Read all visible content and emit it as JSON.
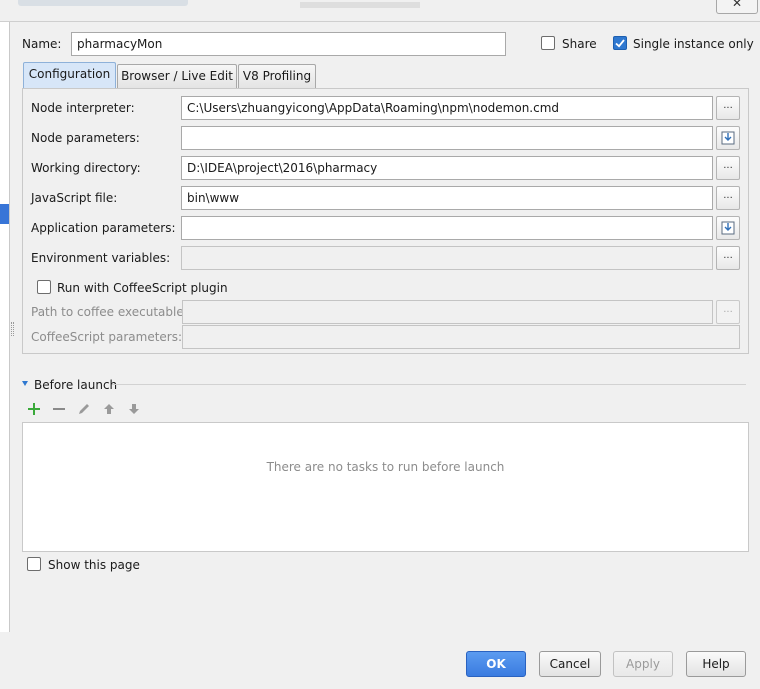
{
  "window": {
    "close_label": "✕"
  },
  "header": {
    "name_label": "Name:",
    "name_value": "pharmacyMon",
    "share_label": "Share",
    "share_checked": false,
    "single_instance_label": "Single instance only",
    "single_instance_checked": true
  },
  "tabs": [
    {
      "label": "Configuration",
      "active": true
    },
    {
      "label": "Browser / Live Edit",
      "active": false
    },
    {
      "label": "V8 Profiling",
      "active": false
    }
  ],
  "config": {
    "node_interpreter": {
      "label": "Node interpreter:",
      "value": "C:\\Users\\zhuangyicong\\AppData\\Roaming\\npm\\nodemon.cmd",
      "button": "..."
    },
    "node_parameters": {
      "label": "Node parameters:",
      "value": ""
    },
    "working_directory": {
      "label": "Working directory:",
      "value": "D:\\IDEA\\project\\2016\\pharmacy",
      "button": "..."
    },
    "javascript_file": {
      "label": "JavaScript file:",
      "value": "bin\\www",
      "button": "..."
    },
    "application_parameters": {
      "label": "Application parameters:",
      "value": ""
    },
    "environment_variables": {
      "label": "Environment variables:",
      "value": "",
      "button": "..."
    },
    "coffeescript_plugin": {
      "label": "Run with CoffeeScript plugin",
      "checked": false
    },
    "coffee_path": {
      "label": "Path to coffee executable:",
      "value": "",
      "button": "..."
    },
    "coffee_params": {
      "label": "CoffeeScript parameters:",
      "value": ""
    }
  },
  "before_launch": {
    "title": "Before launch",
    "toolbar_icons": [
      "add-icon",
      "remove-icon",
      "edit-icon",
      "move-up-icon",
      "move-down-icon"
    ],
    "empty_text": "There are no tasks to run before launch"
  },
  "show_page": {
    "label": "Show this page",
    "checked": false
  },
  "buttons": {
    "ok": "OK",
    "cancel": "Cancel",
    "apply": "Apply",
    "help": "Help"
  },
  "colors": {
    "accent": "#2f78d0",
    "primary_button": "#3a7be0",
    "add_icon": "#3aa93a"
  }
}
